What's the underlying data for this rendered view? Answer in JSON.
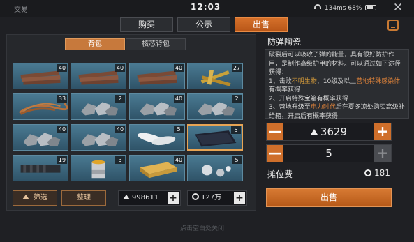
{
  "header": {
    "title": "交易",
    "clock": "12:03",
    "network": "134ms",
    "battery": "68%",
    "close_symbol": "✕"
  },
  "tabs": [
    {
      "label": "购买",
      "active": false
    },
    {
      "label": "公示",
      "active": false
    },
    {
      "label": "出售",
      "active": true
    }
  ],
  "inventory": {
    "subtabs": [
      {
        "label": "背包",
        "active": true
      },
      {
        "label": "核芯背包",
        "active": false
      }
    ],
    "rows": [
      [
        {
          "item": "wood-planks",
          "count": "40"
        },
        {
          "item": "wood-planks",
          "count": "40"
        },
        {
          "item": "wood-planks",
          "count": "40"
        },
        {
          "item": "gold-sticks",
          "count": "27"
        }
      ],
      [
        {
          "item": "fibers",
          "count": "33"
        },
        {
          "item": "metal-scrap",
          "count": "2"
        },
        {
          "item": "metal-scrap",
          "count": "40"
        },
        {
          "item": "metal-scrap",
          "count": "2"
        }
      ],
      [
        {
          "item": "metal-scrap",
          "count": "40"
        },
        {
          "item": "metal-scrap",
          "count": "40"
        },
        {
          "item": "feathers",
          "count": "5"
        },
        {
          "item": "ceramic-plate",
          "count": "5",
          "selected": true
        }
      ],
      [
        {
          "item": "tube",
          "count": "19"
        },
        {
          "item": "paint-can",
          "count": "3"
        },
        {
          "item": "gold-box",
          "count": "40"
        },
        {
          "item": "steel-balls",
          "count": "5"
        }
      ]
    ],
    "filter_label": "筛选",
    "sort_label": "整理",
    "silver_amount": "998611",
    "gold_amount": "127万"
  },
  "detail": {
    "name": "防弹陶瓷",
    "desc_line1": "破裂后可以吸收子弹的能量，具有很好防护作用，是制作高级护甲的材料。可以通过如下途径获得：",
    "desc_item1_a": "1、击败",
    "desc_item1_hl1": "不明生物",
    "desc_item1_b": "、10级及以上",
    "desc_item1_hl2": "营地特殊感染体",
    "desc_item1_c": "有概率获得",
    "desc_item2": "2、开启特殊宝箱有概率获得",
    "desc_item3_a": "3、营地升级至",
    "desc_item3_hl": "电力时代",
    "desc_item3_b": "后在夏冬凉处购买高级补给箱，开启后有概率获得",
    "price": "3629",
    "quantity": "5",
    "fee_label": "摊位费",
    "fee_value": "181",
    "sell_label": "出售",
    "minus_symbol": "—",
    "plus_symbol": "+"
  },
  "footer_hint": "点击空白处关闭",
  "colors": {
    "accent": "#cf6f2b",
    "highlight": "#d49a3a",
    "panel": "#26282c"
  }
}
